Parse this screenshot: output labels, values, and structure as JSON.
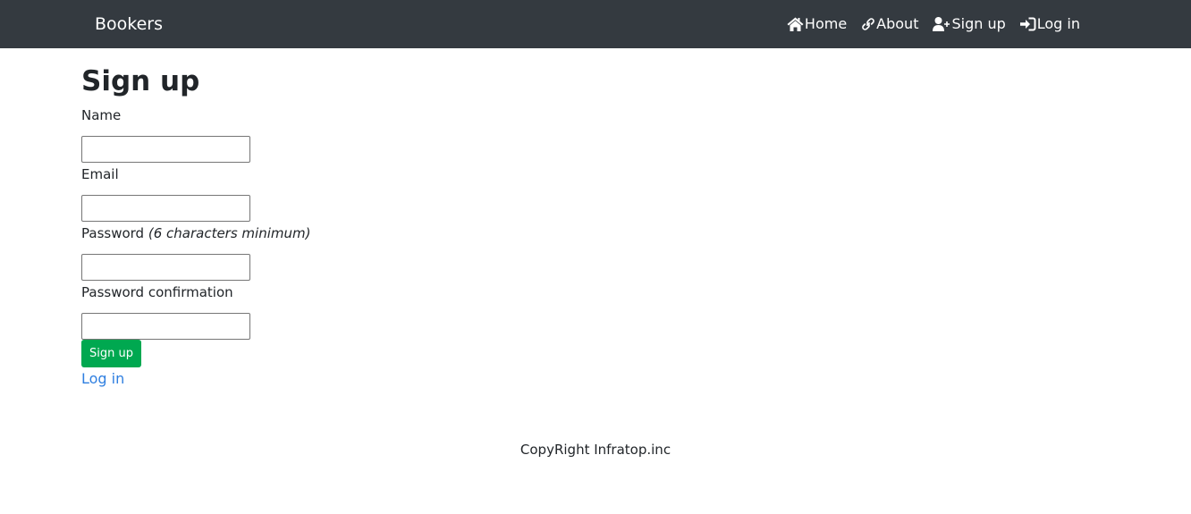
{
  "navbar": {
    "brand": "Bookers",
    "links": [
      {
        "label": "Home",
        "icon": "home-icon"
      },
      {
        "label": "About",
        "icon": "link-icon"
      },
      {
        "label": "Sign up",
        "icon": "user-plus-icon"
      },
      {
        "label": "Log in",
        "icon": "sign-in-icon"
      }
    ],
    "background": "#343a40"
  },
  "main": {
    "title": "Sign up",
    "fields": [
      {
        "label": "Name",
        "value": "",
        "placeholder": ""
      },
      {
        "label": "Email",
        "value": "",
        "placeholder": ""
      },
      {
        "label": "Password",
        "hint": "(6 characters minimum)",
        "value": "",
        "placeholder": ""
      },
      {
        "label": "Password confirmation",
        "value": "",
        "placeholder": ""
      }
    ],
    "submit_label": "Sign up",
    "login_link": "Log in"
  },
  "footer": {
    "text": "CopyRight Infratop.inc"
  },
  "colors": {
    "accent_button": "#00a850",
    "link": "#2f7fe0"
  }
}
